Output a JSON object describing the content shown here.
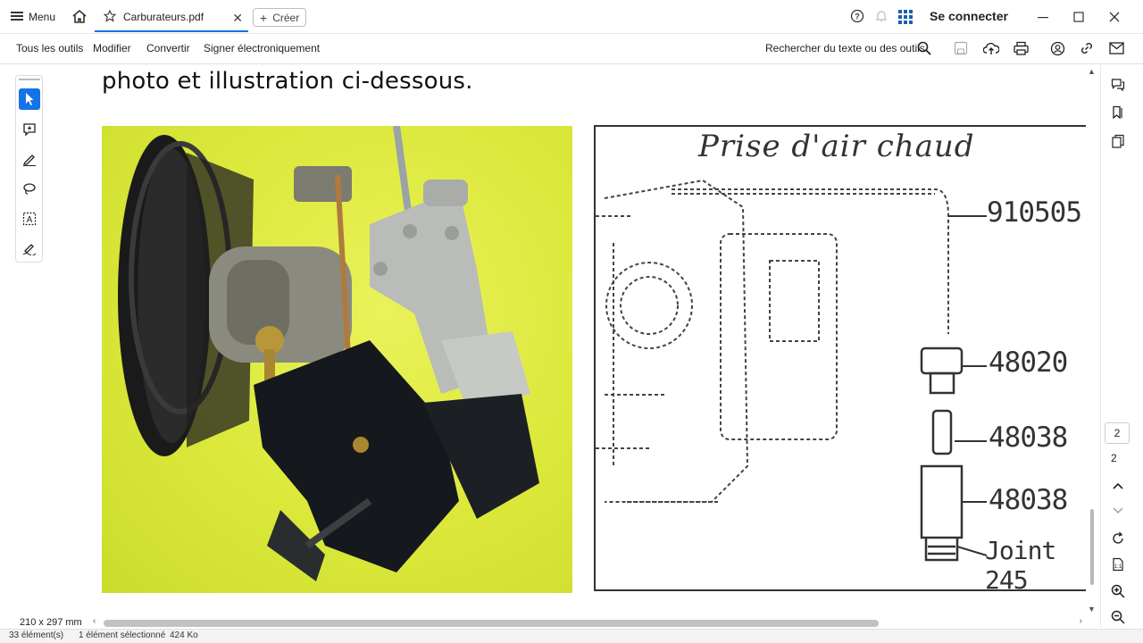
{
  "titlebar": {
    "menu_label": "Menu",
    "tab_title": "Carburateurs.pdf",
    "create_label": "Créer",
    "sign_in": "Se connecter"
  },
  "toolbar": {
    "all_tools": "Tous les outils",
    "edit": "Modifier",
    "convert": "Convertir",
    "sign": "Signer électroniquement",
    "search": "Rechercher du texte ou des outils"
  },
  "document": {
    "text_line": "photo et illustration ci-dessous.",
    "diagram_title": "Prise d'air chaud",
    "parts": [
      "910505",
      "48020",
      "48038",
      "48038",
      "Joint 245"
    ]
  },
  "navigation": {
    "current_page": "2",
    "total_pages": "2",
    "page_size": "210 x 297 mm"
  },
  "statusbar": {
    "items_count": "33 élément(s)",
    "selected": "1 élément sélectionné",
    "size": "424 Ko"
  },
  "colors": {
    "accent": "#1473e6",
    "photo_bg": "#dbe83a"
  }
}
